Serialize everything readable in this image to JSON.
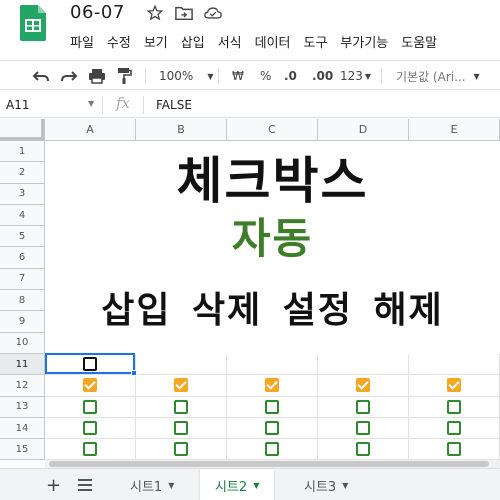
{
  "header": {
    "title": "06-07",
    "menu": [
      "파일",
      "수정",
      "보기",
      "삽입",
      "서식",
      "데이터",
      "도구",
      "부가기능",
      "도움말"
    ]
  },
  "toolbar": {
    "zoom": "100%",
    "currency": "₩",
    "percent": "%",
    "decrease_decimal": ".0",
    "increase_decimal": ".00",
    "more_formats": "123",
    "font": "기본값 (Ari..."
  },
  "formula_bar": {
    "cell_ref": "A11",
    "fx": "fx",
    "value": "FALSE"
  },
  "grid": {
    "columns": [
      "A",
      "B",
      "C",
      "D",
      "E"
    ],
    "rows": [
      "1",
      "2",
      "3",
      "4",
      "5",
      "6",
      "7",
      "8",
      "9",
      "10",
      "11",
      "12",
      "13",
      "14",
      "15"
    ],
    "selected_cell": "A11",
    "banner": {
      "line1": "체크박스",
      "line2": "자동",
      "line3": "삽입 삭제 설정 해제"
    },
    "checkbox_rows": {
      "row11": [
        "unchecked-black",
        "",
        "",
        "",
        ""
      ],
      "row12": [
        "checked",
        "checked",
        "checked",
        "checked",
        "checked"
      ],
      "row13": [
        "unchecked",
        "unchecked",
        "unchecked",
        "unchecked",
        "unchecked"
      ],
      "row14": [
        "unchecked",
        "unchecked",
        "unchecked",
        "unchecked",
        "unchecked"
      ],
      "row15": [
        "unchecked",
        "unchecked",
        "unchecked",
        "unchecked",
        "unchecked"
      ]
    }
  },
  "sheet_tabs": [
    {
      "label": "시트1",
      "active": false
    },
    {
      "label": "시트2",
      "active": true
    },
    {
      "label": "시트3",
      "active": false
    }
  ],
  "colors": {
    "accent_green": "#3e7d2a",
    "checkbox_checked": "#f5a623",
    "checkbox_border": "#2f8a2f",
    "selection": "#1a73e8"
  }
}
